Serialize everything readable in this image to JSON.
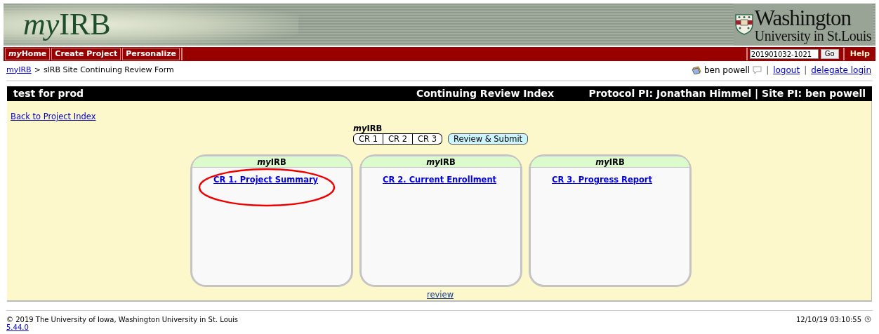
{
  "header": {
    "logo": {
      "italic": "my",
      "text": "IRB"
    },
    "university_line_1": "Washington",
    "university_line_2": "University in St.Louis"
  },
  "nav": {
    "items": [
      {
        "italic": "my",
        "label": "Home"
      },
      {
        "label": "Create Project"
      },
      {
        "label": "Personalize"
      }
    ],
    "search_value": "201901032-1021",
    "go": "Go",
    "help": "Help"
  },
  "breadcrumb": {
    "link": "myIRB",
    "separator": ">",
    "current": "sIRB Site Continuing Review Form"
  },
  "user": {
    "name": "ben powell",
    "links": [
      {
        "separator": "|",
        "label": "logout"
      },
      {
        "separator": "|",
        "label": "delegate login"
      }
    ]
  },
  "title_bar": {
    "project": "test for prod",
    "title": "Continuing Review Index",
    "pis": "Protocol PI: Jonathan Himmel | Site PI: ben powell"
  },
  "back_link": "Back to Project Index",
  "section_nav": {
    "label": {
      "italic": "my",
      "text": "IRB"
    },
    "tabs": [
      "CR 1",
      "CR 2",
      "CR 3"
    ],
    "submit": "Review & Submit"
  },
  "cards": [
    {
      "header": {
        "italic": "my",
        "text": "IRB"
      },
      "link": "CR 1. Project Summary",
      "circled": true
    },
    {
      "header": {
        "italic": "my",
        "text": "IRB"
      },
      "link": "CR 2. Current Enrollment",
      "circled": false
    },
    {
      "header": {
        "italic": "my",
        "text": "IRB"
      },
      "link": "CR 3. Progress Report",
      "circled": false
    }
  ],
  "review_link": "review",
  "footer": {
    "copyright": "© 2019 The University of Iowa, Washington University in St. Louis",
    "version": "5.44.0",
    "timestamp": "12/10/19 03:10:55"
  }
}
